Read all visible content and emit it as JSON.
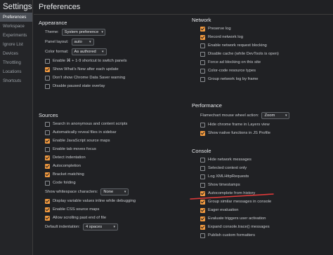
{
  "sidebar": {
    "title": "Settings",
    "items": [
      {
        "label": "Preferences",
        "active": true
      },
      {
        "label": "Workspace"
      },
      {
        "label": "Experiments"
      },
      {
        "label": "Ignore List"
      },
      {
        "label": "Devices"
      },
      {
        "label": "Throttling"
      },
      {
        "label": "Locations"
      },
      {
        "label": "Shortcuts"
      }
    ]
  },
  "pane": {
    "title": "Preferences"
  },
  "appearance": {
    "title": "Appearance",
    "theme": {
      "label": "Theme:",
      "value": "System preference"
    },
    "panel_layout": {
      "label": "Panel layout:",
      "value": "auto"
    },
    "color_format": {
      "label": "Color format:",
      "value": "As authored"
    },
    "checks": [
      {
        "label": "Enable ⌘ + 1-9 shortcut to switch panels",
        "checked": false
      },
      {
        "label": "Show What's New after each update",
        "checked": true
      },
      {
        "label": "Don't show Chrome Data Saver warning",
        "checked": false
      },
      {
        "label": "Disable paused state overlay",
        "checked": false
      }
    ]
  },
  "sources": {
    "title": "Sources",
    "checks1": [
      {
        "label": "Search in anonymous and content scripts",
        "checked": false
      },
      {
        "label": "Automatically reveal files in sidebar",
        "checked": false
      },
      {
        "label": "Enable JavaScript source maps",
        "checked": true
      },
      {
        "label": "Enable tab moves focus",
        "checked": false
      },
      {
        "label": "Detect indentation",
        "checked": true
      },
      {
        "label": "Autocompletion",
        "checked": true
      },
      {
        "label": "Bracket matching",
        "checked": true
      },
      {
        "label": "Code folding",
        "checked": false
      }
    ],
    "whitespace": {
      "label": "Show whitespace characters:",
      "value": "None"
    },
    "checks2": [
      {
        "label": "Display variable values inline while debugging",
        "checked": true
      },
      {
        "label": "Enable CSS source maps",
        "checked": true
      },
      {
        "label": "Allow scrolling past end of file",
        "checked": true
      }
    ],
    "indentation": {
      "label": "Default indentation:",
      "value": "4 spaces"
    }
  },
  "network": {
    "title": "Network",
    "checks": [
      {
        "label": "Preserve log",
        "checked": true
      },
      {
        "label": "Record network log",
        "checked": true
      },
      {
        "label": "Enable network request blocking",
        "checked": false
      },
      {
        "label": "Disable cache (while DevTools is open)",
        "checked": false
      },
      {
        "label": "Force ad blocking on this site",
        "checked": false
      },
      {
        "label": "Color-code resource types",
        "checked": false
      },
      {
        "label": "Group network log by frame",
        "checked": false
      }
    ]
  },
  "performance": {
    "title": "Performance",
    "wheel": {
      "label": "Flamechart mouse wheel action:",
      "value": "Zoom"
    },
    "checks": [
      {
        "label": "Hide chrome frame in Layers view",
        "checked": false
      },
      {
        "label": "Show native functions in JS Profile",
        "checked": true
      }
    ]
  },
  "console": {
    "title": "Console",
    "checks": [
      {
        "label": "Hide network messages",
        "checked": false
      },
      {
        "label": "Selected context only",
        "checked": false
      },
      {
        "label": "Log XMLHttpRequests",
        "checked": false
      },
      {
        "label": "Show timestamps",
        "checked": false
      },
      {
        "label": "Autocomplete from history",
        "checked": true
      },
      {
        "label": "Group similar messages in console",
        "checked": true
      },
      {
        "label": "Eager evaluation",
        "checked": true
      },
      {
        "label": "Evaluate triggers user activation",
        "checked": true
      },
      {
        "label": "Expand console.trace() messages",
        "checked": true
      },
      {
        "label": "Publish custom formatters",
        "checked": false
      }
    ]
  },
  "annotation_color": "#e23a3a",
  "accent_color": "#f29a3f"
}
